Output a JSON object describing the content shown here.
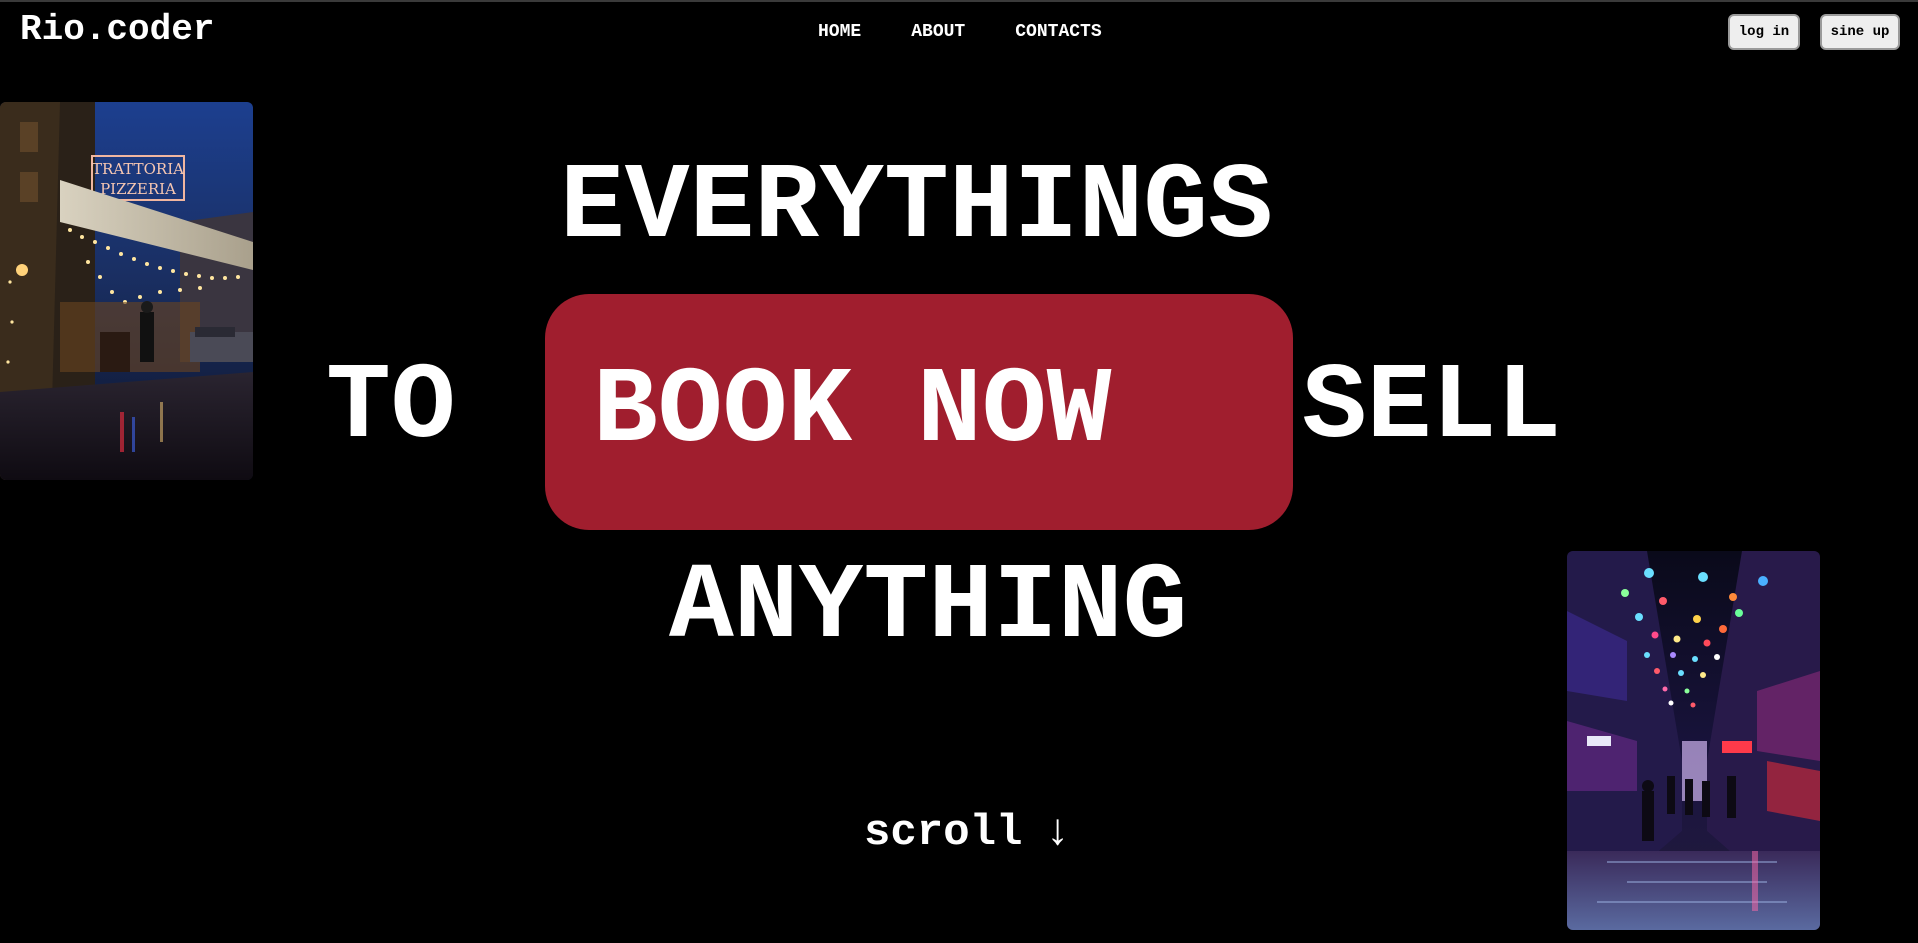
{
  "header": {
    "logo": "Rio.coder",
    "nav": [
      "HOME",
      "ABOUT",
      "CONTACTS"
    ],
    "login_label": "log in",
    "signup_label": "sine up"
  },
  "hero": {
    "line1": "EVERYTHINGS",
    "line2_left": "TO",
    "cta_label": "BOOK NOW",
    "line2_right": "SELL",
    "line3": "ANYTHING"
  },
  "scroll": {
    "label": "scroll",
    "arrow": "↓"
  },
  "images": [
    {
      "name": "trattoria-pizzeria-street-photo",
      "sign_text": "TRATTORIA PIZZERIA"
    },
    {
      "name": "neon-lightbulb-alley-photo"
    }
  ],
  "colors": {
    "background": "#000000",
    "accent": "#a01e2e",
    "text": "#ffffff"
  }
}
